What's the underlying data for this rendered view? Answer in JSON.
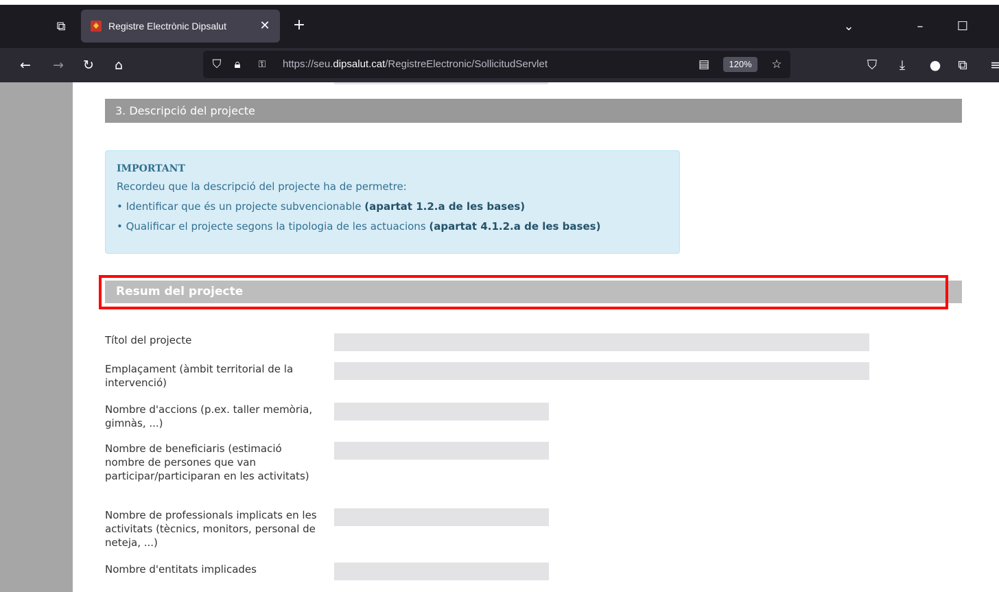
{
  "browser": {
    "tab_title": "Registre Electrònic Dipsalut",
    "url_prefix": "https://seu.",
    "url_host": "dipsalut.cat",
    "url_path": "/RegistreElectronic/SollicitudServlet",
    "zoom": "120%"
  },
  "page": {
    "section_title": "3. Descripció del projecte",
    "important": {
      "title": "IMPORTANT",
      "intro": "Recordeu que la descripció del projecte ha de permetre:",
      "items": [
        {
          "text": "• Identificar que és un projecte subvencionable ",
          "bold": "(apartat 1.2.a de les bases)"
        },
        {
          "text": "• Qualificar el projecte segons la tipologia de les actuacions ",
          "bold": "(apartat 4.1.2.a de les bases)"
        }
      ]
    },
    "resum_title": "Resum del projecte",
    "fields": [
      {
        "label": "Títol del projecte",
        "value": ""
      },
      {
        "label": "Emplaçament (àmbit territorial de la intervenció)",
        "value": ""
      },
      {
        "label": "Nombre d'accions (p.ex. taller memòria, gimnàs, ...)",
        "value": ""
      },
      {
        "label": "Nombre de beneficiaris (estimació nombre de persones que van participar/participaran en les activitats)",
        "value": ""
      },
      {
        "label": "Nombre de professionals implicats en les activitats (tècnics, monitors, personal de neteja, ...)",
        "value": ""
      },
      {
        "label": "Nombre d'entitats implicades",
        "value": ""
      }
    ]
  }
}
